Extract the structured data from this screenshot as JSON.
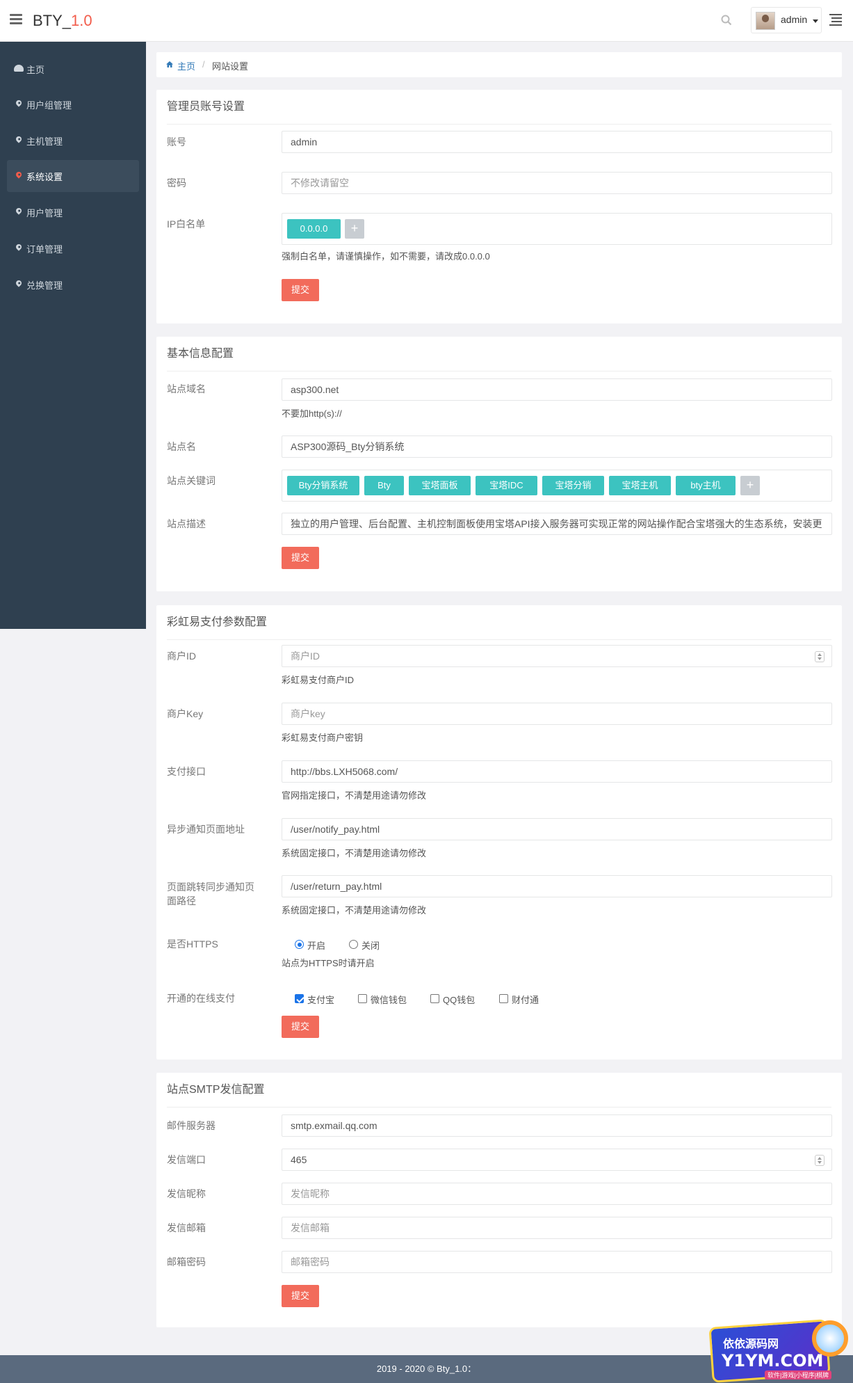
{
  "header": {
    "brand_prefix": "BTY_",
    "brand_version": "1.0",
    "user_name": "admin"
  },
  "sidebar": {
    "items": [
      {
        "label": "主页",
        "icon": "dashboard-icon"
      },
      {
        "label": "用户组管理",
        "icon": "map-marker-icon"
      },
      {
        "label": "主机管理",
        "icon": "map-marker-icon"
      },
      {
        "label": "系统设置",
        "icon": "map-marker-icon",
        "active": true
      },
      {
        "label": "用户管理",
        "icon": "map-marker-icon"
      },
      {
        "label": "订单管理",
        "icon": "map-marker-icon"
      },
      {
        "label": "兑换管理",
        "icon": "map-marker-icon"
      }
    ]
  },
  "breadcrumb": {
    "home": "主页",
    "separator": "/",
    "current": "网站设置"
  },
  "admin_account": {
    "title": "管理员账号设置",
    "account_label": "账号",
    "account_value": "admin",
    "password_label": "密码",
    "password_placeholder": "不修改请留空",
    "ip_label": "IP白名单",
    "ip_tags": [
      "0.0.0.0"
    ],
    "ip_add": "+",
    "ip_help": "强制白名单，请谨慎操作，如不需要，请改成0.0.0.0",
    "submit": "提交"
  },
  "basic_info": {
    "title": "基本信息配置",
    "domain_label": "站点域名",
    "domain_value": "asp300.net",
    "domain_help": "不要加http(s)://",
    "site_name_label": "站点名",
    "site_name_value": "ASP300源码_Bty分销系统",
    "keywords_label": "站点关键词",
    "keywords": [
      "Bty分销系统",
      "Bty",
      "宝塔面板",
      "宝塔IDC",
      "宝塔分销",
      "宝塔主机",
      "bty主机"
    ],
    "keywords_add": "+",
    "desc_label": "站点描述",
    "desc_value": "独立的用户管理、后台配置、主机控制面板使用宝塔API接入服务器可实现正常的网站操作配合宝塔强大的生态系统，安装更",
    "submit": "提交"
  },
  "payment": {
    "title": "彩虹易支付参数配置",
    "merchant_id_label": "商户ID",
    "merchant_id_placeholder": "商户ID",
    "merchant_id_help": "彩虹易支付商户ID",
    "merchant_key_label": "商户Key",
    "merchant_key_placeholder": "商户key",
    "merchant_key_help": "彩虹易支付商户密钥",
    "api_label": "支付接口",
    "api_value": "http://bbs.LXH5068.com/",
    "api_help": "官网指定接口，不清楚用途请勿修改",
    "notify_label": "异步通知页面地址",
    "notify_value": "/user/notify_pay.html",
    "notify_help": "系统固定接口，不清楚用途请勿修改",
    "return_label": "页面跳转同步通知页面路径",
    "return_value": "/user/return_pay.html",
    "return_help": "系统固定接口，不清楚用途请勿修改",
    "https_label": "是否HTTPS",
    "https_on": "开启",
    "https_off": "关闭",
    "https_help": "站点为HTTPS时请开启",
    "methods_label": "开通的在线支付",
    "methods": [
      {
        "label": "支付宝",
        "checked": true
      },
      {
        "label": "微信钱包",
        "checked": false
      },
      {
        "label": "QQ钱包",
        "checked": false
      },
      {
        "label": "财付通",
        "checked": false
      }
    ],
    "submit": "提交"
  },
  "smtp": {
    "title": "站点SMTP发信配置",
    "server_label": "邮件服务器",
    "server_value": "smtp.exmail.qq.com",
    "port_label": "发信端口",
    "port_value": "465",
    "nickname_label": "发信昵称",
    "nickname_placeholder": "发信昵称",
    "email_label": "发信邮箱",
    "email_placeholder": "发信邮箱",
    "password_label": "邮箱密码",
    "password_placeholder": "邮箱密码",
    "submit": "提交"
  },
  "footer": {
    "text": "2019 - 2020 © Bty_1.0："
  },
  "watermark": {
    "cn": "依依源码网",
    "en": "Y1YM.COM",
    "sub": "软件|游戏|小程序|棋牌"
  },
  "colors": {
    "sidebar_bg": "#2f4050",
    "tag_teal": "#3cc3c0",
    "submit_red": "#f26b5b",
    "brand_red": "#f25c4b",
    "link_blue": "#337ab7",
    "footer_bg": "#5a6a7e"
  }
}
